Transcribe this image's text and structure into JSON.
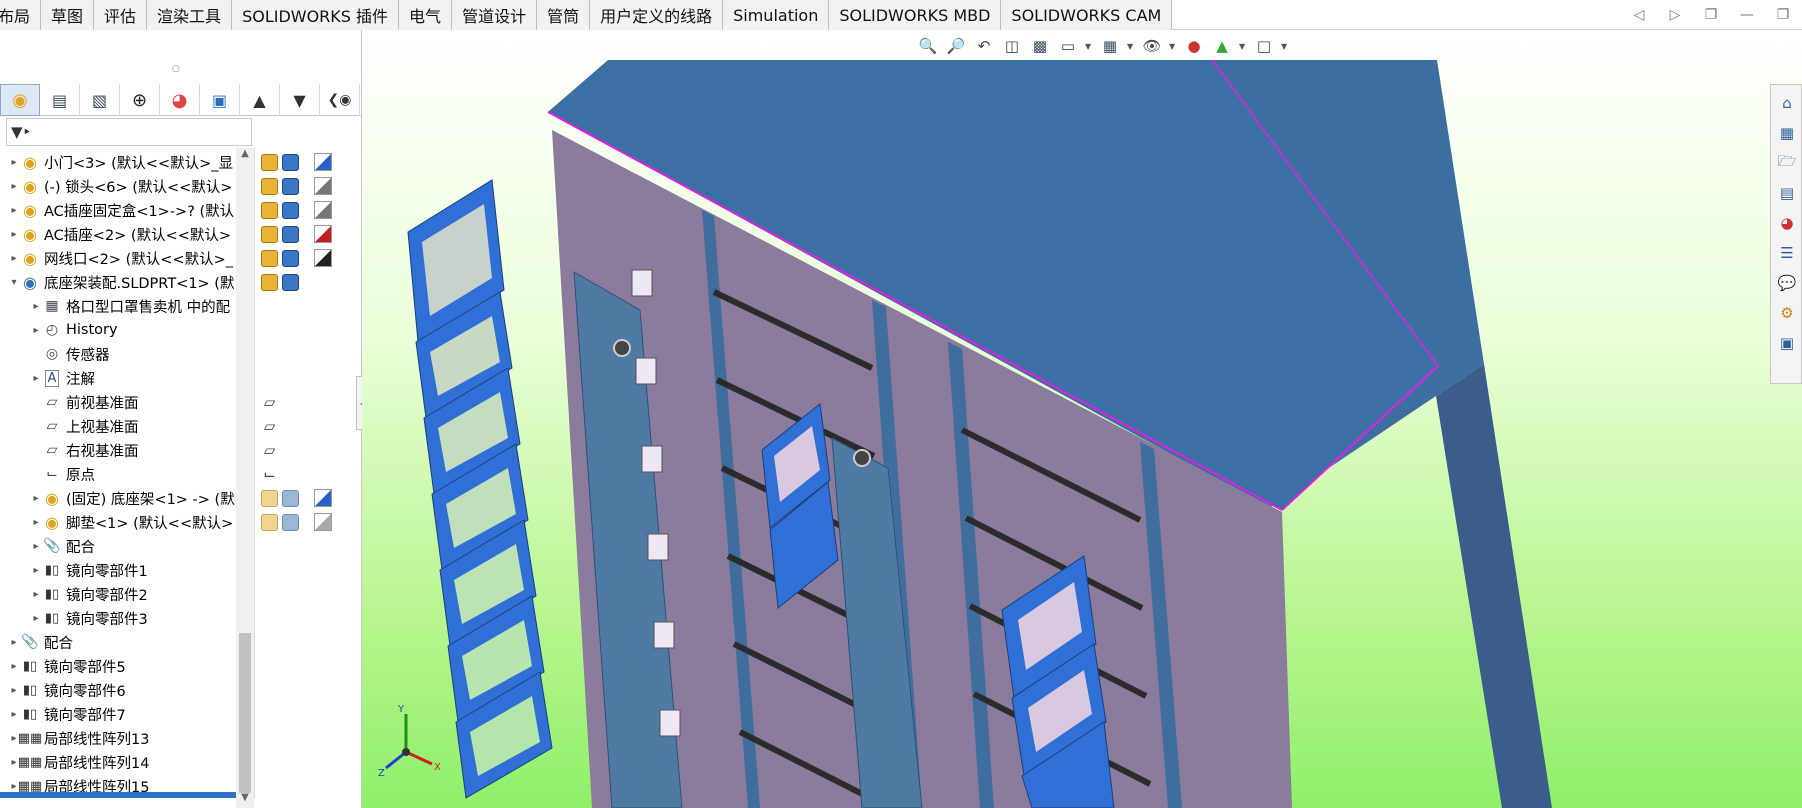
{
  "commandTabs": [
    "布局",
    "草图",
    "评估",
    "渲染工具",
    "SOLIDWORKS 插件",
    "电气",
    "管道设计",
    "管筒",
    "用户定义的线路",
    "Simulation",
    "SOLIDWORKS MBD",
    "SOLIDWORKS CAM"
  ],
  "windowControls": [
    "pin-left-icon",
    "pin-right-icon",
    "restore-icon",
    "minimize-icon",
    "maximize-icon"
  ],
  "managerTabs": [
    "featuremanager-icon",
    "propertymanager-icon",
    "configurationmanager-icon",
    "dimxpert-icon",
    "display-manager-icon",
    "cam-feature-icon",
    "cam-operation-icon",
    "cam-tool-icon",
    "hide-show-icon"
  ],
  "filter": {
    "label": "filter-icon"
  },
  "tree": {
    "items": [
      {
        "indent": 0,
        "arrow": "▸",
        "icon": "assembly-icon",
        "label": "小门<3> (默认<<默认>_显"
      },
      {
        "indent": 0,
        "arrow": "▸",
        "icon": "assembly-icon",
        "label": "(-) 锁头<6> (默认<<默认>"
      },
      {
        "indent": 0,
        "arrow": "▸",
        "icon": "assembly-icon",
        "label": "AC插座固定盒<1>->? (默认"
      },
      {
        "indent": 0,
        "arrow": "▸",
        "icon": "assembly-icon",
        "label": "AC插座<2> (默认<<默认>"
      },
      {
        "indent": 0,
        "arrow": "▸",
        "icon": "assembly-icon",
        "label": "网线口<2> (默认<<默认>_"
      },
      {
        "indent": 0,
        "arrow": "▾",
        "icon": "part-icon",
        "label": "底座架装配.SLDPRT<1> (默"
      },
      {
        "indent": 1,
        "arrow": "▸",
        "icon": "folder-icon",
        "label": "格口型口罩售卖机 中的配"
      },
      {
        "indent": 1,
        "arrow": "▸",
        "icon": "history-icon",
        "label": "History"
      },
      {
        "indent": 1,
        "arrow": "",
        "icon": "sensor-icon",
        "label": "传感器"
      },
      {
        "indent": 1,
        "arrow": "▸",
        "icon": "annotation-icon",
        "label": "注解"
      },
      {
        "indent": 1,
        "arrow": "",
        "icon": "plane-icon",
        "label": "前视基准面"
      },
      {
        "indent": 1,
        "arrow": "",
        "icon": "plane-icon",
        "label": "上视基准面"
      },
      {
        "indent": 1,
        "arrow": "",
        "icon": "plane-icon",
        "label": "右视基准面"
      },
      {
        "indent": 1,
        "arrow": "",
        "icon": "origin-icon",
        "label": "原点"
      },
      {
        "indent": 1,
        "arrow": "▸",
        "icon": "assembly-icon",
        "label": "(固定) 底座架<1> -> (默"
      },
      {
        "indent": 1,
        "arrow": "▸",
        "icon": "assembly-icon",
        "label": "脚垫<1> (默认<<默认>"
      },
      {
        "indent": 1,
        "arrow": "▸",
        "icon": "mate-icon",
        "label": "配合"
      },
      {
        "indent": 1,
        "arrow": "▸",
        "icon": "mirror-icon",
        "label": "镜向零部件1"
      },
      {
        "indent": 1,
        "arrow": "▸",
        "icon": "mirror-icon",
        "label": "镜向零部件2"
      },
      {
        "indent": 1,
        "arrow": "▸",
        "icon": "mirror-icon",
        "label": "镜向零部件3"
      },
      {
        "indent": 0,
        "arrow": "▸",
        "icon": "mate-icon",
        "label": "配合"
      },
      {
        "indent": 0,
        "arrow": "▸",
        "icon": "mirror-icon",
        "label": "镜向零部件5"
      },
      {
        "indent": 0,
        "arrow": "▸",
        "icon": "mirror-icon",
        "label": "镜向零部件6"
      },
      {
        "indent": 0,
        "arrow": "▸",
        "icon": "mirror-icon",
        "label": "镜向零部件7"
      },
      {
        "indent": 0,
        "arrow": "▸",
        "icon": "pattern-icon",
        "label": "局部线性阵列13"
      },
      {
        "indent": 0,
        "arrow": "▸",
        "icon": "pattern-icon",
        "label": "局部线性阵列14"
      },
      {
        "indent": 0,
        "arrow": "▸",
        "icon": "pattern-icon",
        "label": "局部线性阵列15"
      }
    ]
  },
  "headsUpToolbar": [
    "zoom-to-fit-icon",
    "zoom-to-area-icon",
    "previous-view-icon",
    "section-view-icon",
    "dynamic-annotation-icon",
    "view-orientation-icon",
    "display-style-icon",
    "hide-show-items-icon",
    "edit-appearance-icon",
    "apply-scene-icon",
    "view-settings-icon"
  ],
  "taskPane": [
    "home-icon",
    "design-library-icon",
    "file-explorer-icon",
    "view-palette-icon",
    "appearances-icon",
    "custom-properties-icon",
    "forum-icon",
    "solidworks-resources-icon",
    "3d-content-icon"
  ],
  "triad": {
    "x": "X",
    "y": "Y",
    "z": "Z"
  },
  "colors": {
    "viewportTop": "#ffffff",
    "viewportBottom": "#8ff06a",
    "cabinet": "#3d6b98",
    "frame": "#3a7ad2",
    "edgeHighlight": "#e020e0"
  }
}
